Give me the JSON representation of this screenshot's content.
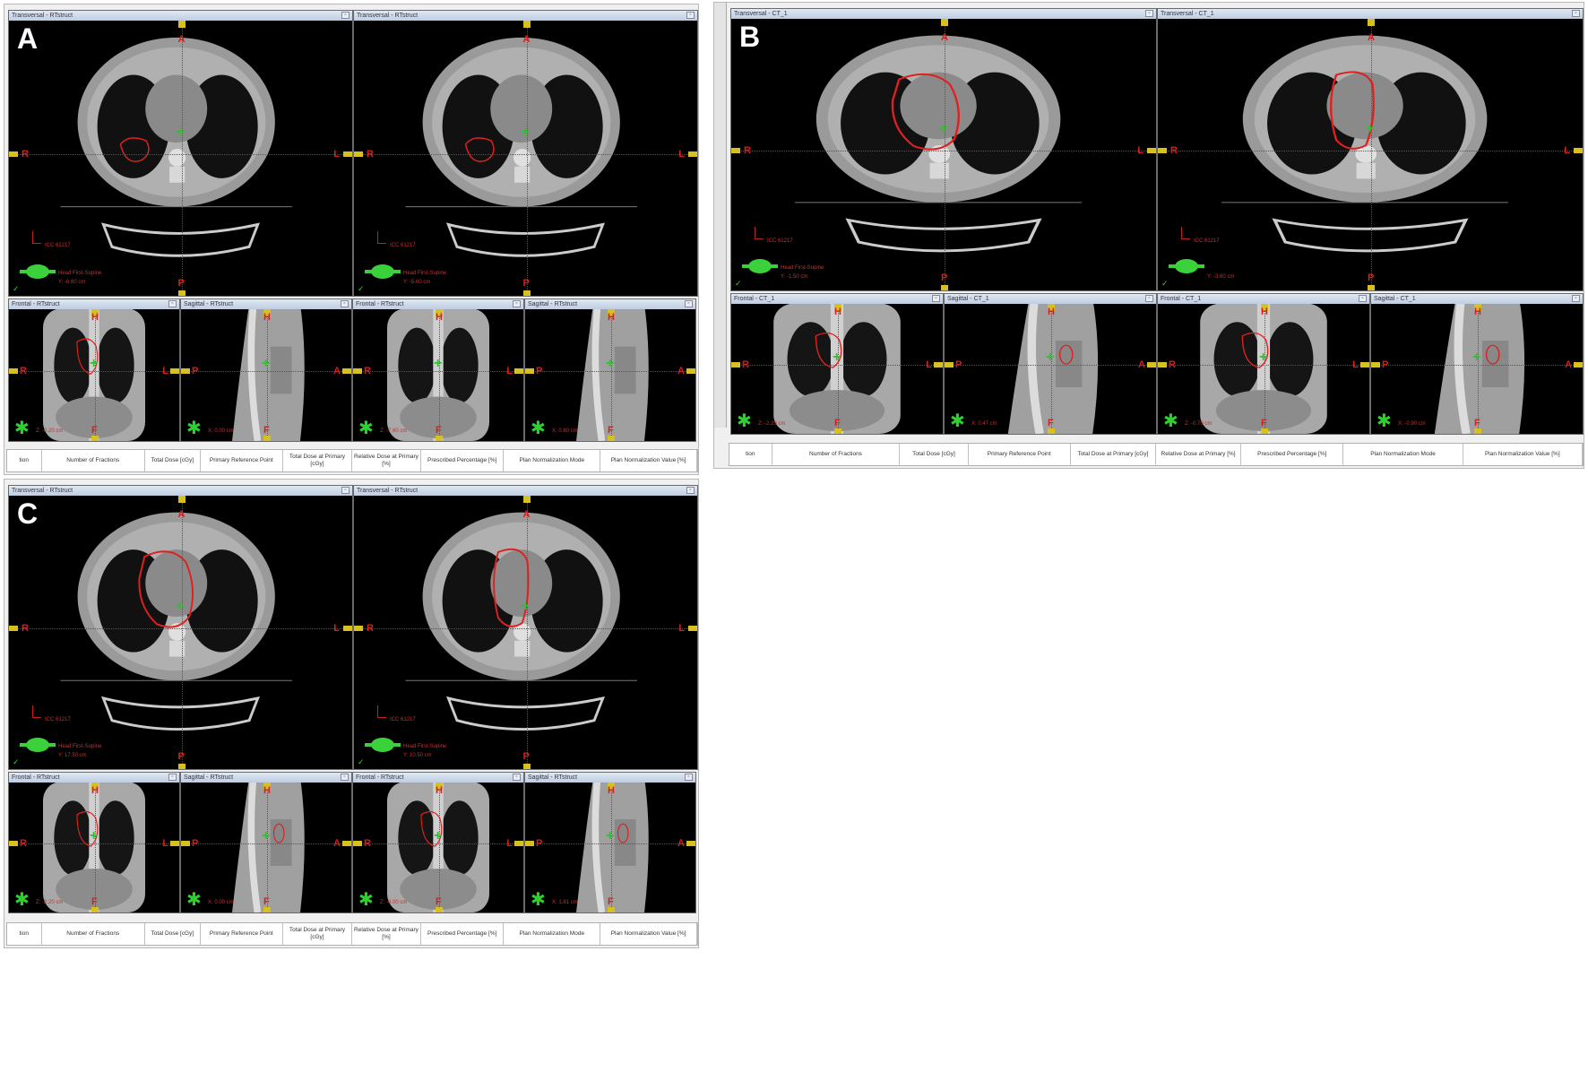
{
  "panels": [
    {
      "letter": "A",
      "transversal": [
        {
          "title": "Transversal - RTstruct",
          "coord": "Y: -6.60 cm",
          "series": "ICC 61217",
          "pos": "Head First-Supine"
        },
        {
          "title": "Transversal - RTstruct",
          "coord": "Y: -5.60 cm",
          "series": "ICC 61217",
          "pos": "Head First-Supine"
        }
      ],
      "small": [
        {
          "title": "Frontal - RTstruct",
          "coord": "Z: -0.20 cm"
        },
        {
          "title": "Sagittal - RTstruct",
          "coord": "X: 0.00 cm"
        },
        {
          "title": "Frontal - RTstruct",
          "coord": "Z: -7.60 cm"
        },
        {
          "title": "Sagittal - RTstruct",
          "coord": "X: 0.60 cm"
        }
      ]
    },
    {
      "letter": "B",
      "transversal": [
        {
          "title": "Transversal - CT_1",
          "coord": "Y: -1.50 cm",
          "series": "ICC 61217",
          "pos": "Head First-Supine"
        },
        {
          "title": "Transversal - CT_1",
          "coord": "Y: -3.60 cm",
          "series": "ICC 61217",
          "pos": ""
        }
      ],
      "small": [
        {
          "title": "Frontal - CT_1",
          "coord": "Z: -2.20 cm"
        },
        {
          "title": "Sagittal - CT_1",
          "coord": "X: 0.47 cm"
        },
        {
          "title": "Frontal - CT_1",
          "coord": "Z: -0.70 cm"
        },
        {
          "title": "Sagittal - CT_1",
          "coord": "X: -0.90 cm"
        }
      ]
    },
    {
      "letter": "C",
      "transversal": [
        {
          "title": "Transversal - RTstruct",
          "coord": "Y: 17.50 cm",
          "series": "ICC 61217",
          "pos": "Head First-Supine"
        },
        {
          "title": "Transversal - RTstruct",
          "coord": "Y: 10.50 cm",
          "series": "ICC 61217",
          "pos": "Head First-Supine"
        }
      ],
      "small": [
        {
          "title": "Frontal - RTstruct",
          "coord": "Z: -2.20 cm"
        },
        {
          "title": "Sagittal - RTstruct",
          "coord": "X: 0.00 cm"
        },
        {
          "title": "Frontal - RTstruct",
          "coord": "Z: -4.00 cm"
        },
        {
          "title": "Sagittal - RTstruct",
          "coord": "X: 1.81 cm"
        }
      ]
    }
  ],
  "orientation": {
    "anterior": "A",
    "posterior": "P",
    "right": "R",
    "left": "L",
    "head": "H",
    "foot": "F"
  },
  "table_headers": [
    "tion",
    "Number of Fractions",
    "Total Dose [cGy]",
    "Primary Reference Point",
    "Total Dose at Primary [cGy]",
    "Relative Dose at Primary [%]",
    "Prescribed Percentage [%]",
    "Plan Normalization Mode",
    "Plan Normalization Value [%]"
  ],
  "colors": {
    "contour": "#e02020",
    "marker": "#30c030",
    "orientation_text": "#d42020",
    "viewport_bg": "#000000"
  },
  "icons": {
    "minimize": "window-button-icon",
    "crosshair": "crosshair-plus-icon",
    "figure": "patient-figure-icon",
    "headfirst": "head-first-supine-icon"
  }
}
